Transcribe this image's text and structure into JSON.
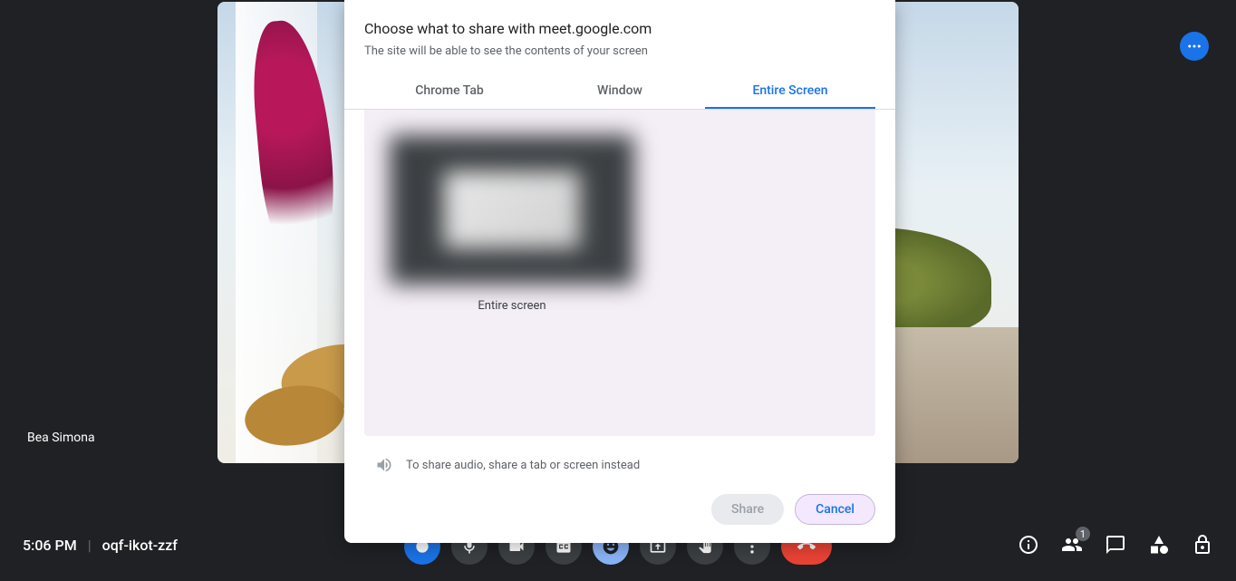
{
  "video": {
    "participant_name": "Bea Simona"
  },
  "footer": {
    "time": "5:06 PM",
    "meeting_code": "oqf-ikot-zzf"
  },
  "right_panel": {
    "participant_count": "1"
  },
  "modal": {
    "title": "Choose what to share with meet.google.com",
    "subtitle": "The site will be able to see the contents of your screen",
    "tabs": {
      "chrome_tab": "Chrome Tab",
      "window": "Window",
      "entire_screen": "Entire Screen"
    },
    "thumbnail_label": "Entire screen",
    "audio_hint": "To share audio, share a tab or screen instead",
    "share_label": "Share",
    "cancel_label": "Cancel"
  }
}
